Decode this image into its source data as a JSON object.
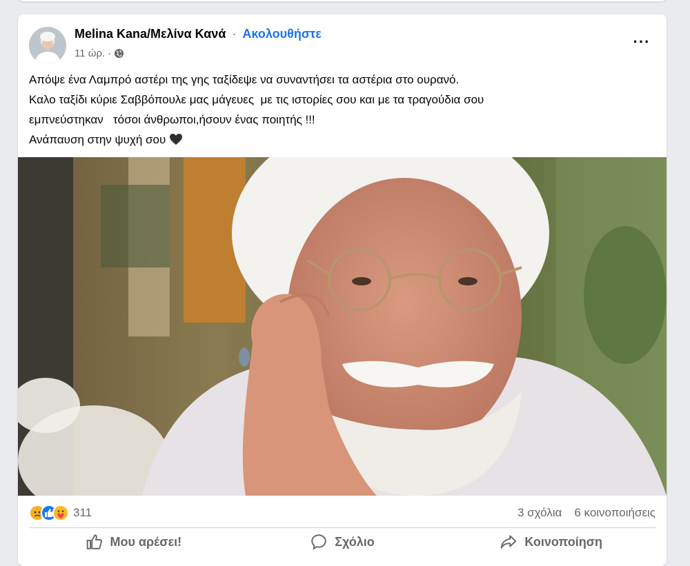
{
  "post": {
    "author": "Melina Kana/Μελίνα Κανά",
    "separator": "·",
    "follow_label": "Ακολουθήστε",
    "time": "11 ώρ.",
    "time_separator": "·",
    "audience_icon": "globe-icon",
    "more_icon": "more-options-icon",
    "more_label": "···",
    "caption_lines": [
      "Απόψε ένα Λαμπρό αστέρι της γης ταξίδεψε να συναντήσει τα αστέρια στο ουρανό.",
      "Καλο ταξίδι κύριε Σαββόπουλε μας μάγευες  με τις ιστορίες σου και με τα τραγούδια σου",
      "εμπνεύστηκαν   τόσοι άνθρωποι,ήσουν ένας ποιητής !!!",
      "Ανάπαυση στην ψυχή σου"
    ],
    "caption_emoji": "black-heart-icon"
  },
  "reactions": {
    "icons": [
      "sad-reaction-icon",
      "like-reaction-icon",
      "care-reaction-icon"
    ],
    "count": "311",
    "comments": "3 σχόλια",
    "shares": "6 κοινοποιήσεις"
  },
  "actions": {
    "like_label": "Μου αρέσει!",
    "comment_label": "Σχόλιο",
    "share_label": "Κοινοποίηση"
  },
  "colors": {
    "accent": "#1b74e4",
    "like_blue": "#1877f2",
    "sad_yellow": "#f7b125",
    "care_yellow": "#f7b928"
  }
}
